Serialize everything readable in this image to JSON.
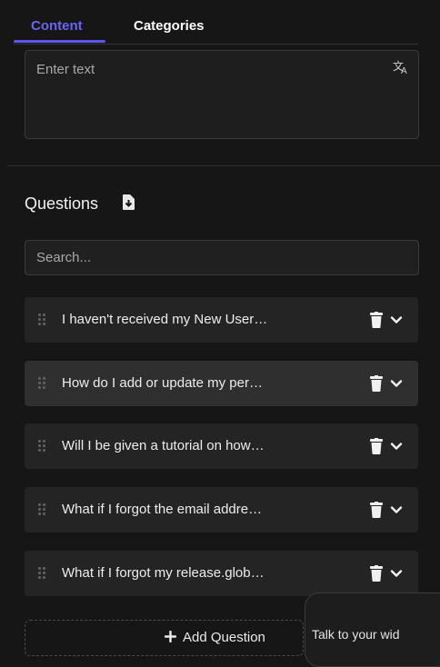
{
  "tabs": [
    {
      "label": "Content",
      "active": true
    },
    {
      "label": "Categories",
      "active": false
    }
  ],
  "content_field": {
    "placeholder": "Enter text",
    "icon": "translate-icon"
  },
  "questions": {
    "title": "Questions",
    "export_icon": "file-download-icon",
    "search_placeholder": "Search...",
    "items": [
      {
        "label": "I haven't received my New User…",
        "highlighted": false
      },
      {
        "label": "How do I add or update my per…",
        "highlighted": true
      },
      {
        "label": "Will I be given a tutorial on how…",
        "highlighted": false
      },
      {
        "label": "What if I forgot the email addre…",
        "highlighted": false
      },
      {
        "label": "What if I forgot my release.glob…",
        "highlighted": false
      }
    ],
    "add_label": "Add Question"
  },
  "chat_widget": {
    "label": "Talk to your wid"
  },
  "colors": {
    "accent": "#5b54f0",
    "background": "#161616",
    "row": "#242424"
  }
}
